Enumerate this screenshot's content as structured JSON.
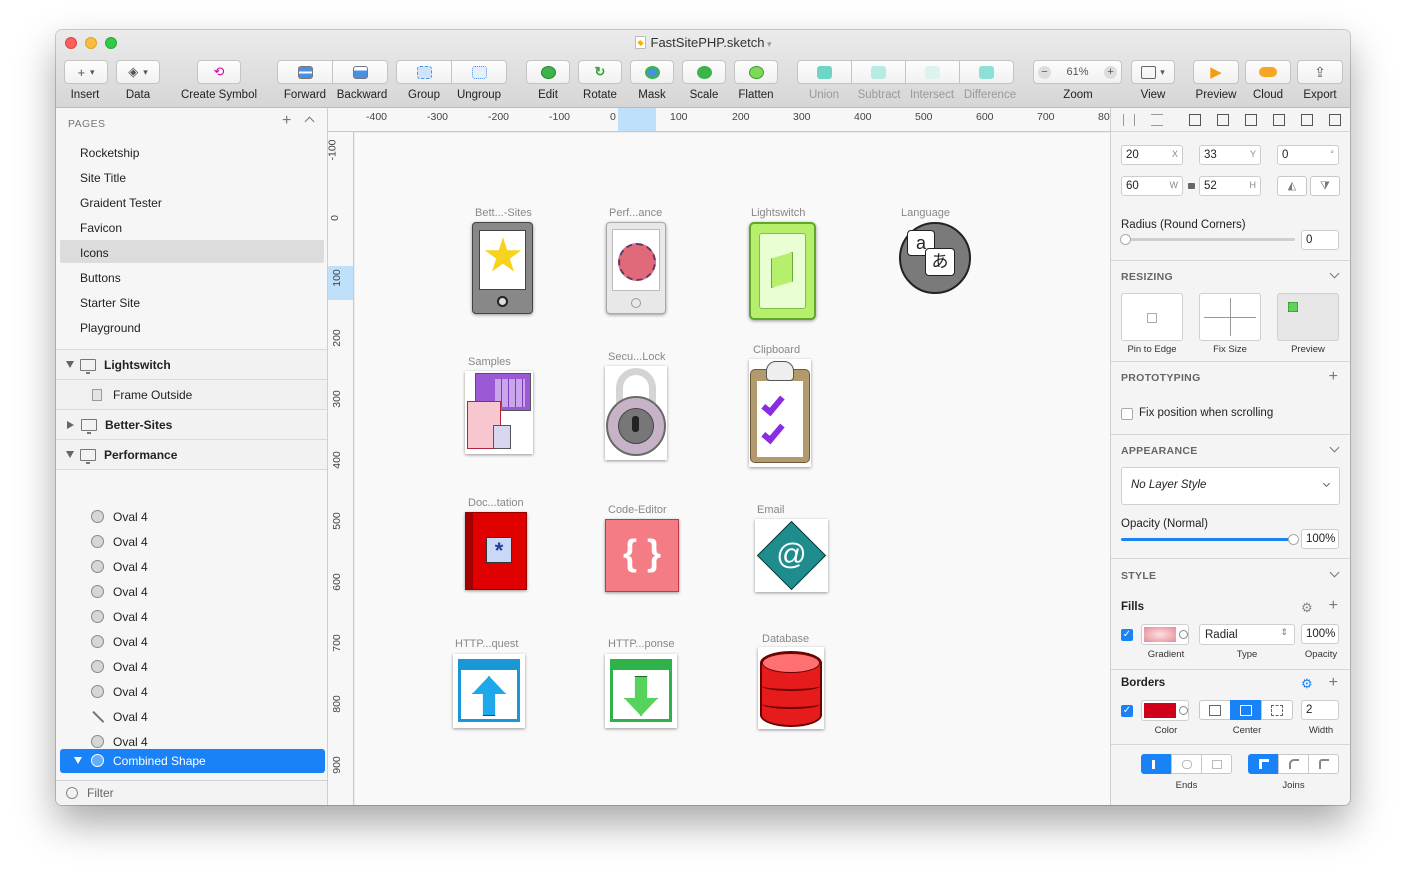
{
  "window": {
    "title": "FastSitePHP.sketch"
  },
  "toolbar": {
    "insert": "Insert",
    "data": "Data",
    "create_symbol": "Create Symbol",
    "forward": "Forward",
    "backward": "Backward",
    "group": "Group",
    "ungroup": "Ungroup",
    "edit": "Edit",
    "rotate": "Rotate",
    "mask": "Mask",
    "scale": "Scale",
    "flatten": "Flatten",
    "union": "Union",
    "subtract": "Subtract",
    "intersect": "Intersect",
    "difference": "Difference",
    "zoom_value": "61%",
    "zoom": "Zoom",
    "view": "View",
    "preview": "Preview",
    "cloud": "Cloud",
    "export": "Export"
  },
  "pages": {
    "header": "PAGES",
    "items": [
      "Rocketship",
      "Site Title",
      "Graident Tester",
      "Favicon",
      "Icons",
      "Buttons",
      "Starter Site",
      "Playground"
    ],
    "selected": "Icons"
  },
  "layers": {
    "lightswitch": "Lightswitch",
    "frame_outside": "Frame Outside",
    "better_sites": "Better-Sites",
    "performance": "Performance",
    "oval": "Oval 4",
    "combined_shape": "Combined Shape",
    "filter": "Filter"
  },
  "ruler_h": [
    "-400",
    "-300",
    "-200",
    "-100",
    "0",
    "100",
    "200",
    "300",
    "400",
    "500",
    "600",
    "700",
    "80"
  ],
  "ruler_v": [
    "-100",
    "0",
    "100",
    "200",
    "300",
    "400",
    "500",
    "600",
    "700",
    "800",
    "900"
  ],
  "artboards": {
    "better_sites": "Bett...-Sites",
    "performance": "Perf...ance",
    "lightswitch": "Lightswitch",
    "language": "Language",
    "samples": "Samples",
    "security_lock": "Secu...Lock",
    "clipboard": "Clipboard",
    "documentation": "Doc...tation",
    "code_editor": "Code-Editor",
    "email": "Email",
    "http_request": "HTTP...quest",
    "http_response": "HTTP...ponse",
    "database": "Database"
  },
  "inspector": {
    "x": "20",
    "y": "33",
    "rotation": "0",
    "w": "60",
    "h": "52",
    "x_unit": "X",
    "y_unit": "Y",
    "rot_unit": "°",
    "w_unit": "W",
    "h_unit": "H",
    "radius_label": "Radius (Round Corners)",
    "radius_value": "0",
    "resizing": "RESIZING",
    "pin_to_edge": "Pin to Edge",
    "fix_size": "Fix Size",
    "preview": "Preview",
    "prototyping": "PROTOTYPING",
    "fix_position": "Fix position when scrolling",
    "appearance": "APPEARANCE",
    "layer_style": "No Layer Style",
    "opacity_label": "Opacity (Normal)",
    "opacity_value": "100%",
    "style": "STYLE",
    "fills": "Fills",
    "fill_type": "Radial",
    "fill_opacity": "100%",
    "gradient": "Gradient",
    "type": "Type",
    "opacity": "Opacity",
    "borders": "Borders",
    "border_width": "2",
    "color": "Color",
    "center": "Center",
    "width": "Width",
    "ends": "Ends",
    "joins": "Joins"
  },
  "colors": {
    "accent": "#1a82f7",
    "fill": "#e88a96",
    "border": "#d0021b"
  }
}
